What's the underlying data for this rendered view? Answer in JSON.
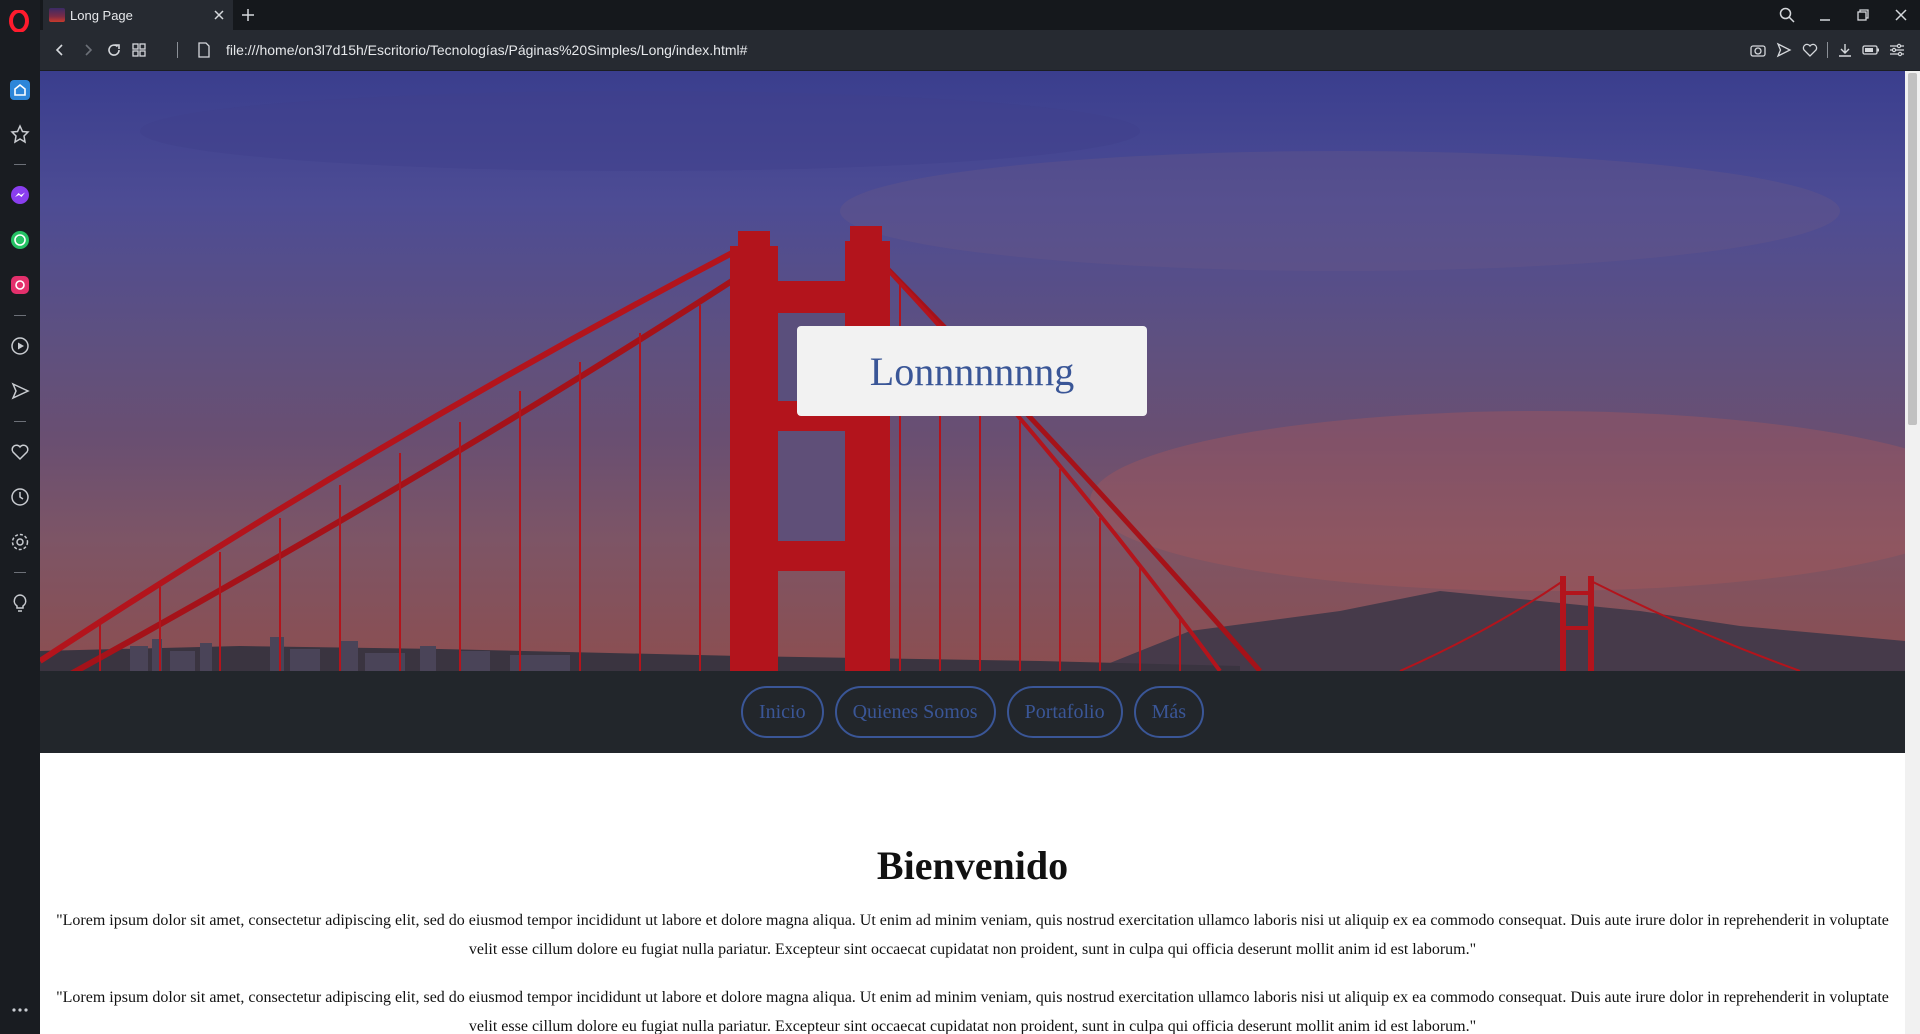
{
  "browser": {
    "tab": {
      "title": "Long Page"
    },
    "address": {
      "url": "file:///home/on3l7d15h/Escritorio/Tecnologías/Páginas%20Simples/Long/index.html#"
    }
  },
  "sidebar": {
    "icons": [
      "home-icon",
      "bookmarks-icon",
      "messenger-icon",
      "whatsapp-icon",
      "instagram-icon",
      "player-icon",
      "flow-icon",
      "my-flow-heart-icon",
      "history-icon",
      "settings-icon",
      "tips-lightbulb-icon",
      "more-icon"
    ]
  },
  "page": {
    "hero_title": "Lonnnnnnng",
    "nav": [
      "Inicio",
      "Quienes Somos",
      "Portafolio",
      "Más"
    ],
    "heading": "Bienvenido",
    "paragraphs": [
      "\"Lorem ipsum dolor sit amet, consectetur adipiscing elit, sed do eiusmod tempor incididunt ut labore et dolore magna aliqua. Ut enim ad minim veniam, quis nostrud exercitation ullamco laboris nisi ut aliquip ex ea commodo consequat. Duis aute irure dolor in reprehenderit in voluptate velit esse cillum dolore eu fugiat nulla pariatur. Excepteur sint occaecat cupidatat non proident, sunt in culpa qui officia deserunt mollit anim id est laborum.\"",
      "\"Lorem ipsum dolor sit amet, consectetur adipiscing elit, sed do eiusmod tempor incididunt ut labore et dolore magna aliqua. Ut enim ad minim veniam, quis nostrud exercitation ullamco laboris nisi ut aliquip ex ea commodo consequat. Duis aute irure dolor in reprehenderit in voluptate velit esse cillum dolore eu fugiat nulla pariatur. Excepteur sint occaecat cupidatat non proident, sunt in culpa qui officia deserunt mollit anim id est laborum.\""
    ]
  },
  "colors": {
    "accent": "#3a5697",
    "navbar_bg": "#22262b",
    "bridge_red": "#b3141c"
  }
}
